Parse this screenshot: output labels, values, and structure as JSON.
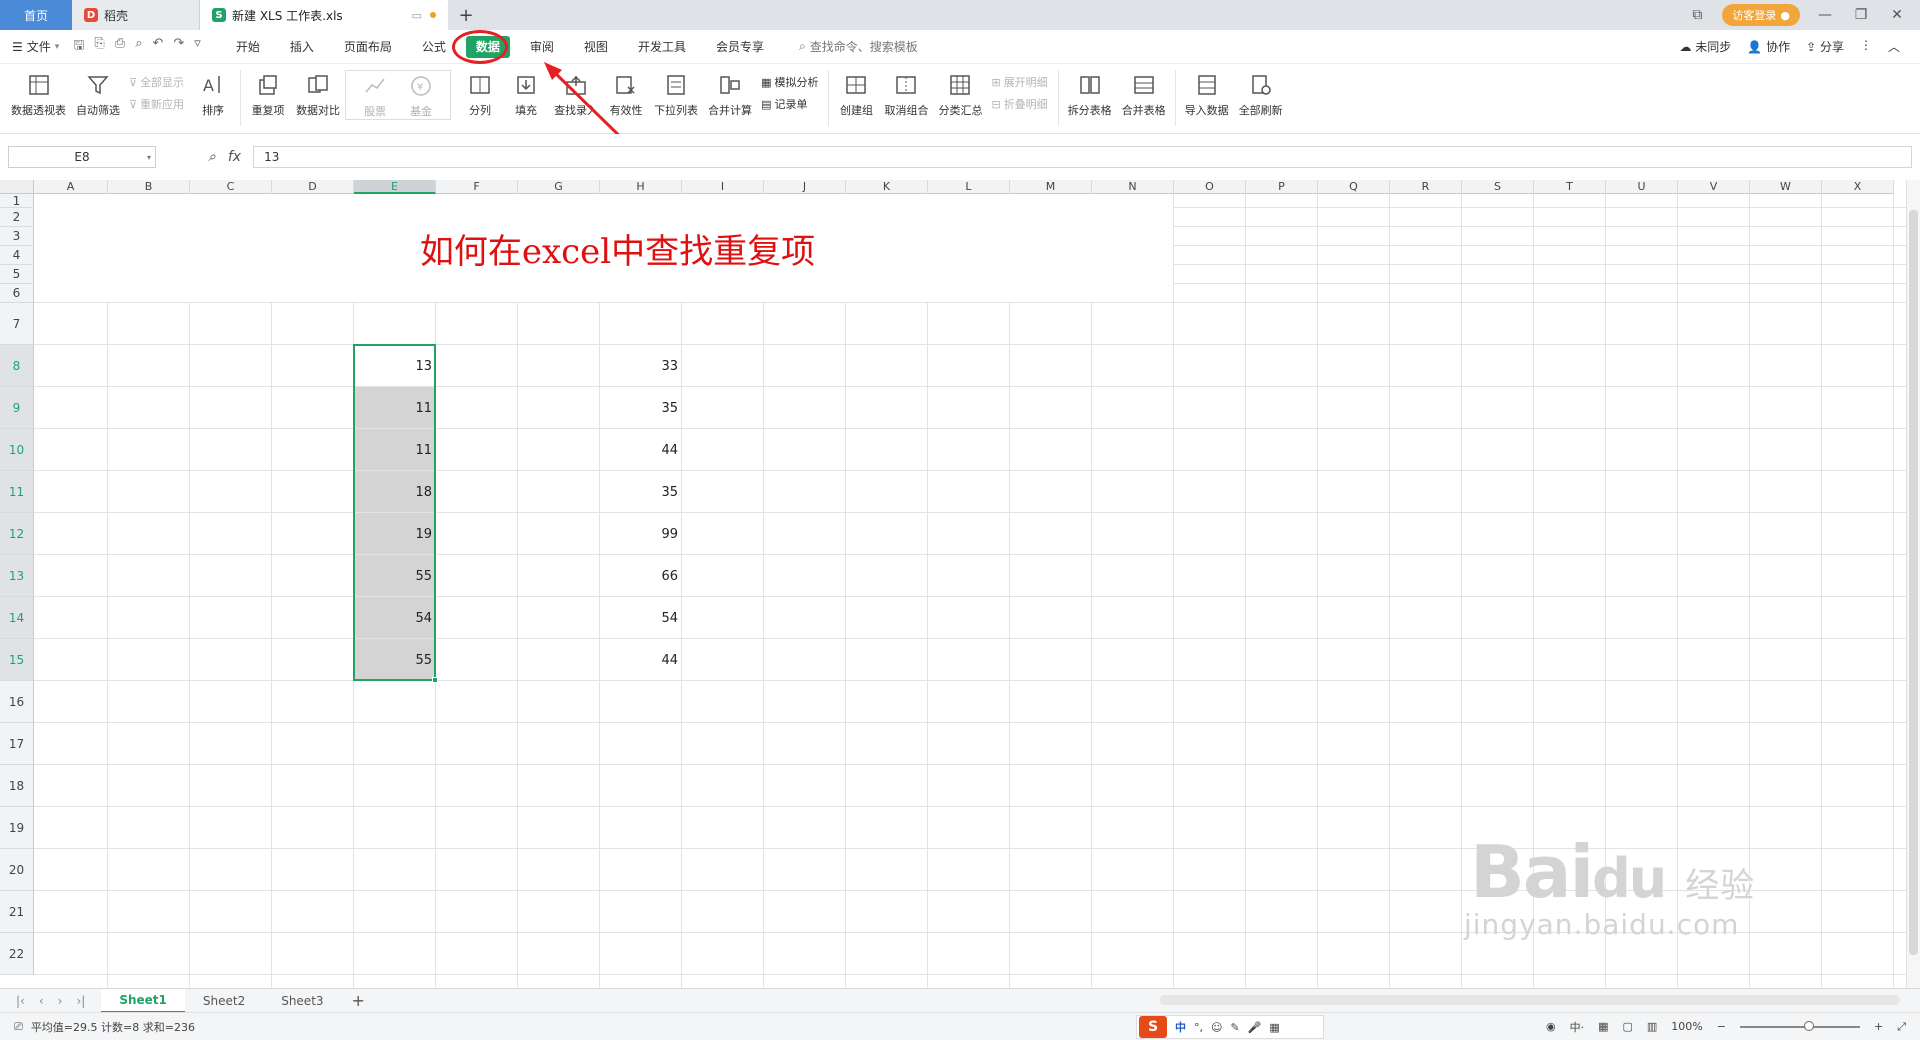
{
  "tabs": {
    "home": "首页",
    "daoke": "稻壳",
    "file": "新建 XLS 工作表.xls",
    "add": "+",
    "login": "访客登录"
  },
  "menu": {
    "file": "文件",
    "items": [
      "开始",
      "插入",
      "页面布局",
      "公式",
      "数据",
      "审阅",
      "视图",
      "开发工具",
      "会员专享"
    ],
    "active_index": 4,
    "search": "查找命令、搜索模板",
    "right": [
      "未同步",
      "协作",
      "分享"
    ]
  },
  "ribbon": {
    "pivot": "数据透视表",
    "autofilter": "自动筛选",
    "showall": "全部显示",
    "reapply": "重新应用",
    "sort": "排序",
    "duplicate": "重复项",
    "compare": "数据对比",
    "stock": "股票",
    "fund": "基金",
    "split": "分列",
    "fill": "填充",
    "lookup": "查找录入",
    "validity": "有效性",
    "dropdown": "下拉列表",
    "merge_calc": "合并计算",
    "simulate": "模拟分析",
    "record": "记录单",
    "group": "创建组",
    "ungroup": "取消组合",
    "subtotal": "分类汇总",
    "expand": "展开明细",
    "collapse": "折叠明细",
    "split_table": "拆分表格",
    "merge_table": "合并表格",
    "import": "导入数据",
    "refresh": "全部刷新"
  },
  "formula_bar": {
    "name_box": "E8",
    "fx": "fx",
    "value": "13"
  },
  "grid": {
    "columns": [
      "A",
      "B",
      "C",
      "D",
      "E",
      "F",
      "G",
      "H",
      "I",
      "J",
      "K",
      "L",
      "M",
      "N",
      "O",
      "P",
      "Q",
      "R",
      "S",
      "T",
      "U",
      "V",
      "W",
      "X"
    ],
    "rows": [
      "1",
      "2",
      "3",
      "4",
      "5",
      "6",
      "7",
      "8",
      "9",
      "10",
      "11",
      "12",
      "13",
      "14",
      "15",
      "16",
      "17",
      "18",
      "19",
      "20",
      "21",
      "22"
    ],
    "selected_column": "E",
    "title": "如何在excel中查找重复项",
    "column_e": [
      "13",
      "11",
      "11",
      "18",
      "19",
      "55",
      "54",
      "55"
    ],
    "column_h": [
      "33",
      "35",
      "44",
      "35",
      "99",
      "66",
      "54",
      "44"
    ]
  },
  "sheets": {
    "tabs": [
      "Sheet1",
      "Sheet2",
      "Sheet3"
    ],
    "active": "Sheet1"
  },
  "status": {
    "summary": "平均值=29.5  计数=8  求和=236",
    "zoom": "100%",
    "ime_lang": "中"
  },
  "watermark": {
    "brand": "Bai",
    "brand2": "du",
    "cn": "经验",
    "url": "jingyan.baidu.com"
  },
  "colors": {
    "accent": "#21a366",
    "annotation": "#e52020",
    "title_red": "#e01010"
  }
}
